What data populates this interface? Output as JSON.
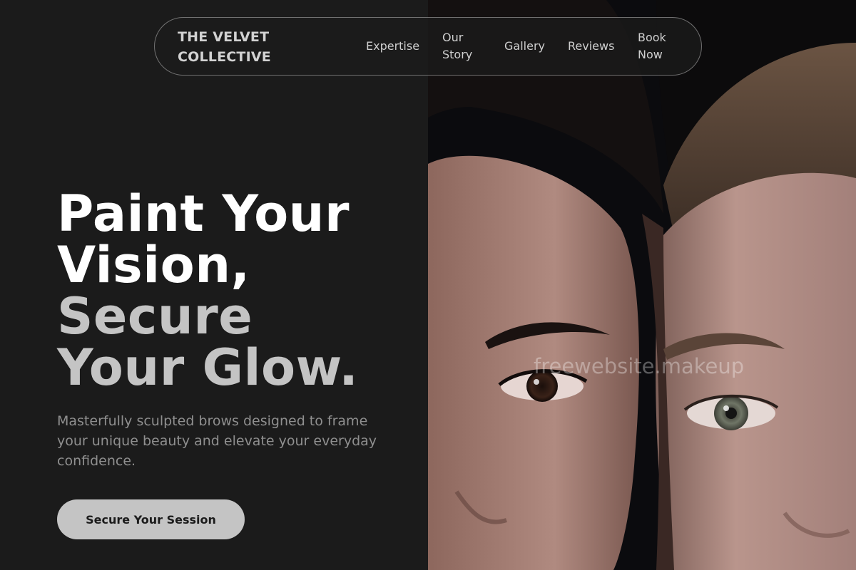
{
  "nav": {
    "brand": "THE VELVET COLLECTIVE",
    "links": [
      "Expertise",
      "Our Story",
      "Gallery",
      "Reviews",
      "Book Now"
    ]
  },
  "hero": {
    "title_line1": "Paint Your",
    "title_line2": "Vision,",
    "title_line3": "Secure",
    "title_line4": "Your Glow.",
    "subtitle": "Masterfully sculpted brows designed to frame your unique beauty and elevate your everyday confidence.",
    "cta_label": "Secure Your Session"
  },
  "watermark": "freewebsite.makeup",
  "colors": {
    "background": "#1b1b1b",
    "title_white": "#ffffff",
    "title_grey": "#c4c4c4",
    "subtitle": "#8f8f8f",
    "cta_bg": "#c4c4c4"
  }
}
